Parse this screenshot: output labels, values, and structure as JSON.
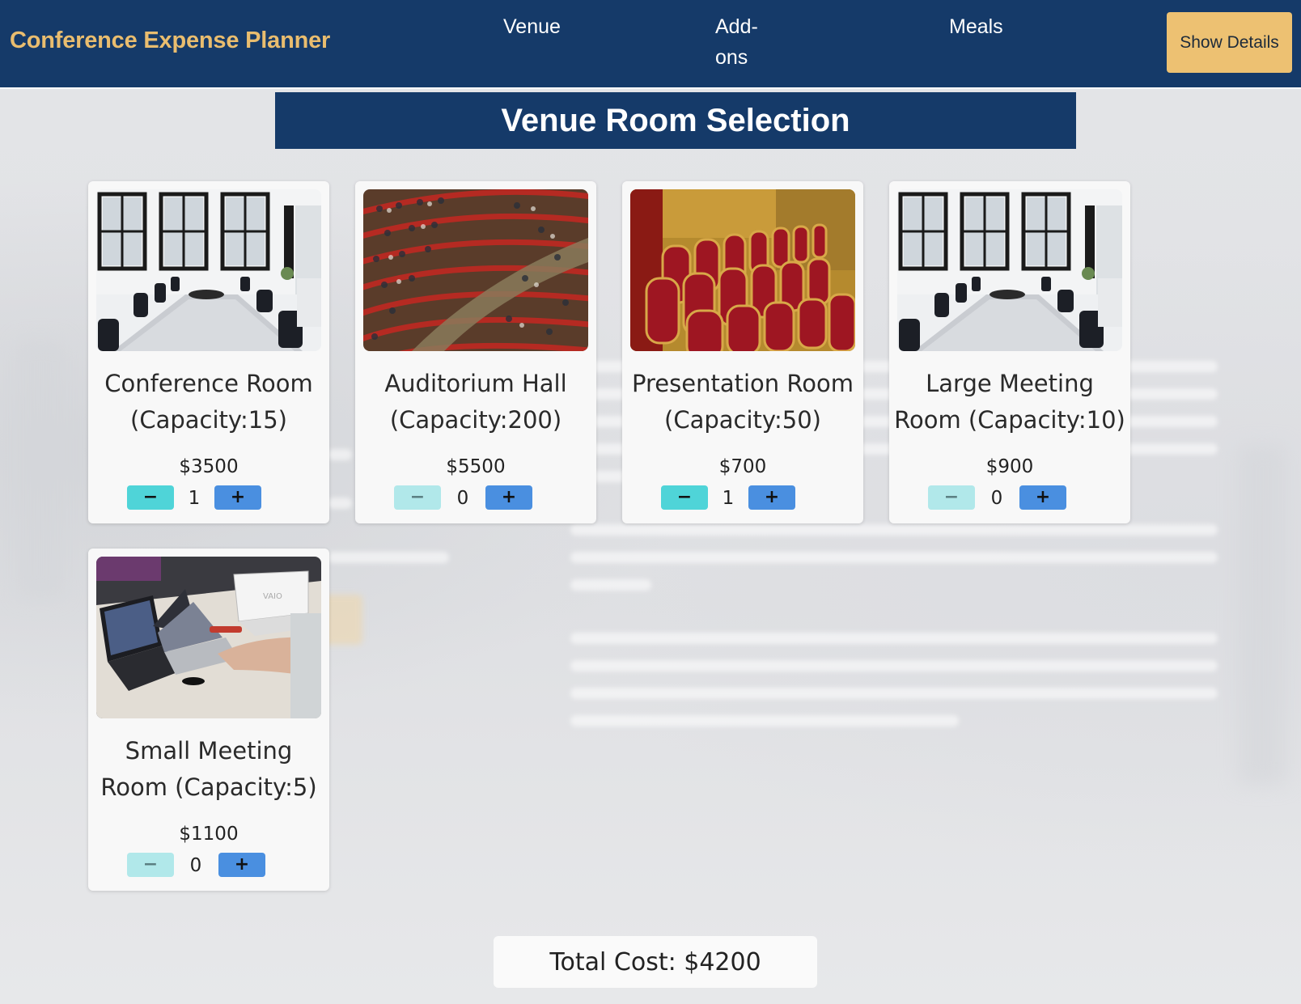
{
  "app": {
    "title": "Conference Expense Planner"
  },
  "nav": {
    "venue": "Venue",
    "addons": "Add-ons",
    "meals": "Meals",
    "show_details": "Show Details"
  },
  "section_title": "Venue Room Selection",
  "rooms": [
    {
      "name": "Conference Room (Capacity:15)",
      "price": "$3500",
      "quantity": "1",
      "image": "conference-room-photo"
    },
    {
      "name": "Auditorium Hall (Capacity:200)",
      "price": "$5500",
      "quantity": "0",
      "image": "auditorium-photo"
    },
    {
      "name": "Presentation Room (Capacity:50)",
      "price": "$700",
      "quantity": "1",
      "image": "presentation-room-photo"
    },
    {
      "name": "Large Meeting Room (Capacity:10)",
      "price": "$900",
      "quantity": "0",
      "image": "conference-room-photo"
    },
    {
      "name": "Small Meeting Room (Capacity:5)",
      "price": "$1100",
      "quantity": "0",
      "image": "laptops-meeting-photo"
    }
  ],
  "controls": {
    "minus": "−",
    "plus": "+"
  },
  "total": "Total Cost: $4200",
  "colors": {
    "navbar": "#153a69",
    "brand": "#e9bd6f",
    "show_details_button": "#edc172",
    "minus_button": "#4fd4d8",
    "minus_button_disabled": "#b1e8ea",
    "plus_button": "#4a8fe0"
  }
}
